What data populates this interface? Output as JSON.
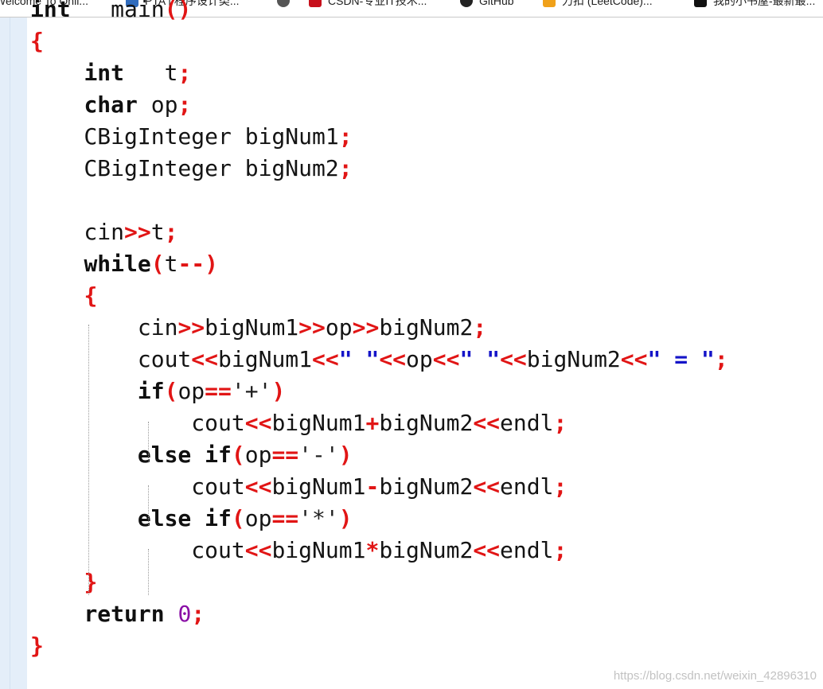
{
  "bookmarks": [
    {
      "label": "Welcome To Onli...",
      "icon": "site-icon",
      "color": "#ffffff"
    },
    {
      "label": "PTA | 程序设计类...",
      "icon": "pta-icon",
      "color": "#2f6bbd"
    },
    {
      "label": "",
      "icon": "globe-icon",
      "color": "#555555"
    },
    {
      "label": "CSDN-专业IT技术...",
      "icon": "csdn-icon",
      "color": "#c7101c"
    },
    {
      "label": "GitHub",
      "icon": "github-icon",
      "color": "#222222"
    },
    {
      "label": "力扣 (LeetCode)...",
      "icon": "leetcode-icon",
      "color": "#f0a11a"
    },
    {
      "label": "我的小书屋-最新最...",
      "icon": "book-icon",
      "color": "#111111"
    }
  ],
  "code": {
    "lines": [
      [
        [
          "kw",
          "int"
        ],
        [
          "",
          "   main"
        ],
        [
          "op",
          "()"
        ]
      ],
      [
        [
          "op",
          "{"
        ]
      ],
      [
        [
          "",
          "    "
        ],
        [
          "kw",
          "int"
        ],
        [
          "",
          "   t"
        ],
        [
          "op",
          ";"
        ]
      ],
      [
        [
          "",
          "    "
        ],
        [
          "kw",
          "char"
        ],
        [
          "",
          " op"
        ],
        [
          "op",
          ";"
        ]
      ],
      [
        [
          "",
          "    CBigInteger bigNum1"
        ],
        [
          "op",
          ";"
        ]
      ],
      [
        [
          "",
          "    CBigInteger bigNum2"
        ],
        [
          "op",
          ";"
        ]
      ],
      [
        [
          "",
          ""
        ]
      ],
      [
        [
          "",
          "    cin"
        ],
        [
          "op",
          ">>"
        ],
        [
          "",
          "t"
        ],
        [
          "op",
          ";"
        ]
      ],
      [
        [
          "",
          "    "
        ],
        [
          "kw",
          "while"
        ],
        [
          "op",
          "("
        ],
        [
          "",
          "t"
        ],
        [
          "op",
          "--)"
        ]
      ],
      [
        [
          "",
          "    "
        ],
        [
          "op",
          "{"
        ]
      ],
      [
        [
          "",
          "        cin"
        ],
        [
          "op",
          ">>"
        ],
        [
          "",
          "bigNum1"
        ],
        [
          "op",
          ">>"
        ],
        [
          "",
          "op"
        ],
        [
          "op",
          ">>"
        ],
        [
          "",
          "bigNum2"
        ],
        [
          "op",
          ";"
        ]
      ],
      [
        [
          "",
          "        cout"
        ],
        [
          "op",
          "<<"
        ],
        [
          "",
          "bigNum1"
        ],
        [
          "op",
          "<<"
        ],
        [
          "str",
          "\" \""
        ],
        [
          "op",
          "<<"
        ],
        [
          "",
          "op"
        ],
        [
          "op",
          "<<"
        ],
        [
          "str",
          "\" \""
        ],
        [
          "op",
          "<<"
        ],
        [
          "",
          "bigNum2"
        ],
        [
          "op",
          "<<"
        ],
        [
          "str",
          "\" = \""
        ],
        [
          "op",
          ";"
        ]
      ],
      [
        [
          "",
          "        "
        ],
        [
          "kw",
          "if"
        ],
        [
          "op",
          "("
        ],
        [
          "",
          "op"
        ],
        [
          "op",
          "=="
        ],
        [
          "chr",
          "'+'"
        ],
        [
          "op",
          ")"
        ]
      ],
      [
        [
          "",
          "            cout"
        ],
        [
          "op",
          "<<"
        ],
        [
          "",
          "bigNum1"
        ],
        [
          "op",
          "+"
        ],
        [
          "",
          "bigNum2"
        ],
        [
          "op",
          "<<"
        ],
        [
          "",
          "endl"
        ],
        [
          "op",
          ";"
        ]
      ],
      [
        [
          "",
          "        "
        ],
        [
          "kw",
          "else"
        ],
        [
          "",
          " "
        ],
        [
          "kw",
          "if"
        ],
        [
          "op",
          "("
        ],
        [
          "",
          "op"
        ],
        [
          "op",
          "=="
        ],
        [
          "chr",
          "'-'"
        ],
        [
          "op",
          ")"
        ]
      ],
      [
        [
          "",
          "            cout"
        ],
        [
          "op",
          "<<"
        ],
        [
          "",
          "bigNum1"
        ],
        [
          "op",
          "-"
        ],
        [
          "",
          "bigNum2"
        ],
        [
          "op",
          "<<"
        ],
        [
          "",
          "endl"
        ],
        [
          "op",
          ";"
        ]
      ],
      [
        [
          "",
          "        "
        ],
        [
          "kw",
          "else"
        ],
        [
          "",
          " "
        ],
        [
          "kw",
          "if"
        ],
        [
          "op",
          "("
        ],
        [
          "",
          "op"
        ],
        [
          "op",
          "=="
        ],
        [
          "chr",
          "'*'"
        ],
        [
          "op",
          ")"
        ]
      ],
      [
        [
          "",
          "            cout"
        ],
        [
          "op",
          "<<"
        ],
        [
          "",
          "bigNum1"
        ],
        [
          "op",
          "*"
        ],
        [
          "",
          "bigNum2"
        ],
        [
          "op",
          "<<"
        ],
        [
          "",
          "endl"
        ],
        [
          "op",
          ";"
        ]
      ],
      [
        [
          "",
          "    "
        ],
        [
          "op",
          "}"
        ]
      ],
      [
        [
          "",
          "    "
        ],
        [
          "kw",
          "return"
        ],
        [
          "",
          " "
        ],
        [
          "num",
          "0"
        ],
        [
          "op",
          ";"
        ]
      ],
      [
        [
          "op",
          "}"
        ]
      ]
    ]
  },
  "watermark": "https://blog.csdn.net/weixin_42896310",
  "colors": {
    "gutter": "#e4eef9",
    "operator": "#e11515",
    "string": "#1414c8",
    "number": "#8a0fa6",
    "keyword": "#101010"
  }
}
